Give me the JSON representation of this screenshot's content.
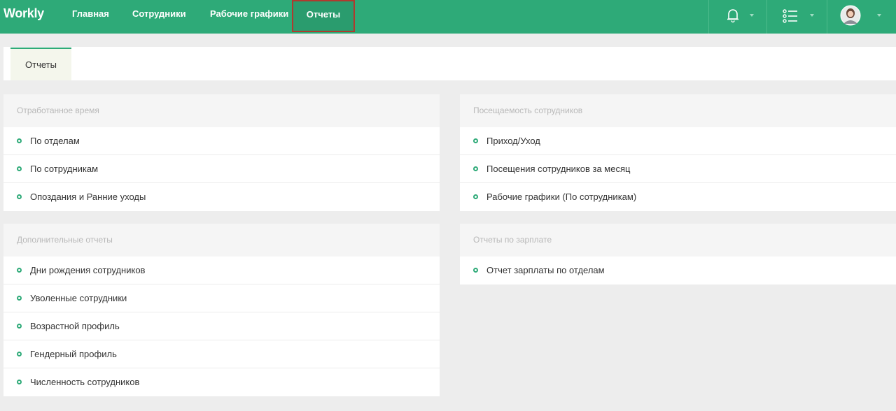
{
  "app": {
    "logo": "Workly"
  },
  "nav": {
    "items": [
      {
        "label": "Главная"
      },
      {
        "label": "Сотрудники"
      },
      {
        "label": "Рабочие графики"
      },
      {
        "label": "Отчеты"
      }
    ],
    "active_index": 3
  },
  "toolbar": {
    "notifications_icon": "bell-icon",
    "list_icon": "list-icon",
    "user_icon": "avatar"
  },
  "tabs": [
    {
      "label": "Отчеты"
    }
  ],
  "cards": [
    {
      "title": "Отработанное время",
      "items": [
        {
          "label": "По отделам"
        },
        {
          "label": "По сотрудникам"
        },
        {
          "label": "Опоздания и Ранние уходы"
        }
      ]
    },
    {
      "title": "Посещаемость сотрудников",
      "items": [
        {
          "label": "Приход/Уход"
        },
        {
          "label": "Посещения сотрудников за месяц"
        },
        {
          "label": "Рабочие графики (По сотрудникам)"
        }
      ]
    },
    {
      "title": "Дополнительные отчеты",
      "items": [
        {
          "label": "Дни рождения сотрудников"
        },
        {
          "label": "Уволенные сотрудники"
        },
        {
          "label": "Возрастной профиль"
        },
        {
          "label": "Гендерный профиль"
        },
        {
          "label": "Численность сотрудников"
        }
      ]
    },
    {
      "title": "Отчеты по зарплате",
      "items": [
        {
          "label": "Отчет зарплаты по отделам"
        }
      ]
    }
  ],
  "colors": {
    "brand": "#2eaa78",
    "active_outline": "#b03a2e",
    "background": "#ededed"
  }
}
